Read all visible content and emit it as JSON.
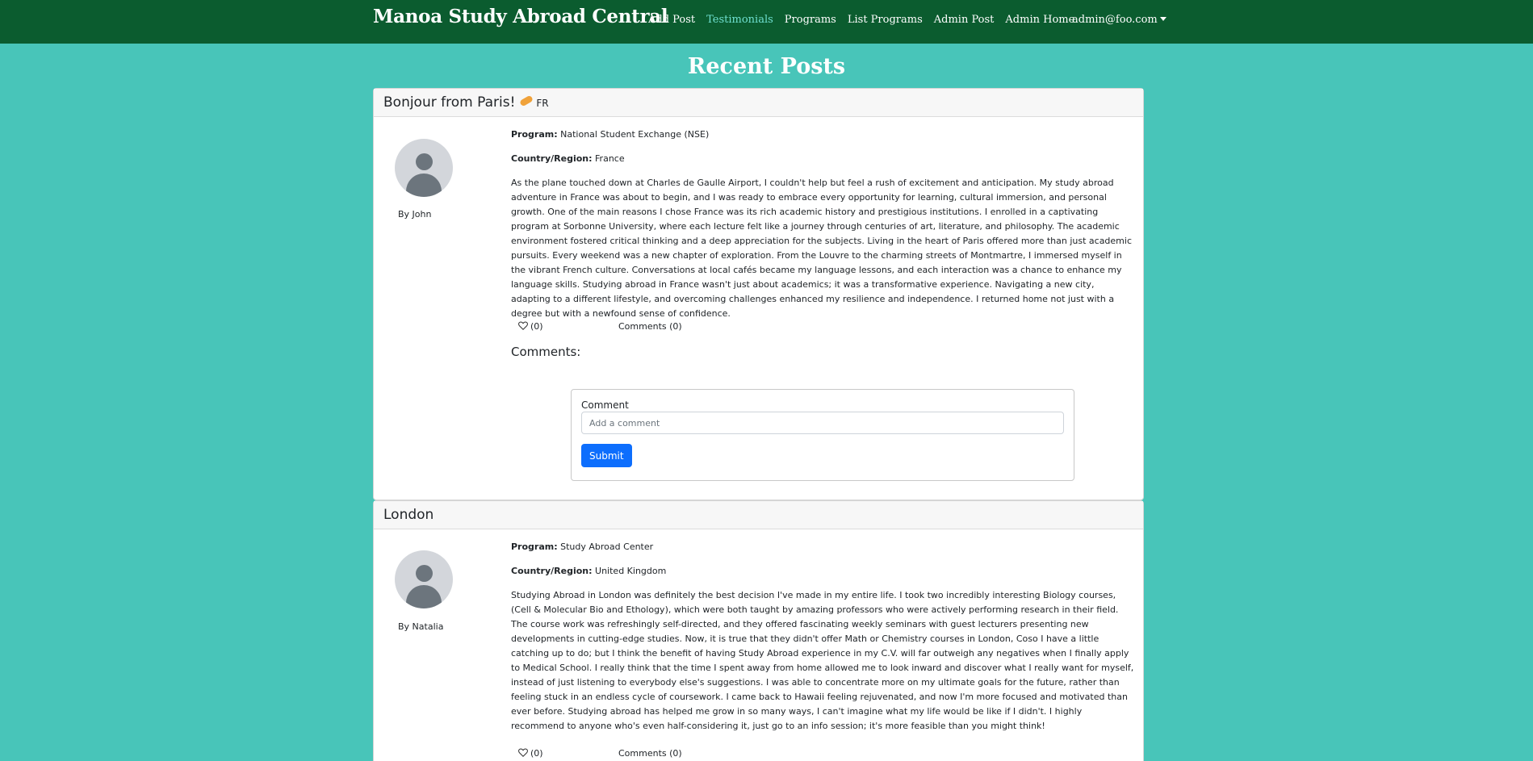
{
  "navbar": {
    "brand": "Manoa Study Abroad Central",
    "links": [
      "Add Post",
      "Testimonials",
      "Programs",
      "List Programs",
      "Admin Post",
      "Admin Home"
    ],
    "active_link": "Testimonials",
    "user": "admin@foo.com"
  },
  "page_title": "Recent Posts",
  "posts": [
    {
      "title": "Bonjour from Paris!",
      "flag_code": "FR",
      "author": "By John",
      "program_label": "Program:",
      "program": "National Student Exchange (NSE)",
      "country_label": "Country/Region:",
      "country": "France",
      "body": "As the plane touched down at Charles de Gaulle Airport, I couldn't help but feel a rush of excitement and anticipation. My study abroad adventure in France was about to begin, and I was ready to embrace every opportunity for learning, cultural immersion, and personal growth. One of the main reasons I chose France was its rich academic history and prestigious institutions. I enrolled in a captivating program at Sorbonne University, where each lecture felt like a journey through centuries of art, literature, and philosophy. The academic environment fostered critical thinking and a deep appreciation for the subjects. Living in the heart of Paris offered more than just academic pursuits. Every weekend was a new chapter of exploration. From the Louvre to the charming streets of Montmartre, I immersed myself in the vibrant French culture. Conversations at local cafés became my language lessons, and each interaction was a chance to enhance my language skills. Studying abroad in France wasn't just about academics; it was a transformative experience. Navigating a new city, adapting to a different lifestyle, and overcoming challenges enhanced my resilience and independence. I returned home not just with a degree but with a newfound sense of confidence.",
      "likes": "(0)",
      "comments_count": "Comments (0)",
      "comments_heading": "Comments:",
      "comment_form": {
        "label": "Comment",
        "placeholder": "Add a comment",
        "submit": "Submit"
      }
    },
    {
      "title": "London",
      "author": "By Natalia",
      "program_label": "Program:",
      "program": "Study Abroad Center",
      "country_label": "Country/Region:",
      "country": "United Kingdom",
      "body": "Studying Abroad in London was definitely the best decision I've made in my entire life. I took two incredibly interesting Biology courses, (Cell & Molecular Bio and Ethology), which were both taught by amazing professors who were actively performing research in their field. The course work was refreshingly self-directed, and they offered fascinating weekly seminars with guest lecturers presenting new developments in cutting-edge studies. Now, it is true that they didn't offer Math or Chemistry courses in London, Coso I have a little catching up to do; but I think the benefit of having Study Abroad experience in my C.V. will far outweigh any negatives when I finally apply to Medical School. I really think that the time I spent away from home allowed me to look inward and discover what I really want for myself, instead of just listening to everybody else's suggestions. I was able to concentrate more on my ultimate goals for the future, rather than feeling stuck in an endless cycle of coursework. I came back to Hawaii feeling rejuvenated, and now I'm more focused and motivated than ever before. Studying abroad has helped me grow in so many ways, I can't imagine what my life would be like if I didn't. I highly recommend to anyone who's even half-considering it, just go to an info session; it's more feasible than you might think!",
      "likes": "(0)",
      "comments_count": "Comments (0)"
    }
  ]
}
